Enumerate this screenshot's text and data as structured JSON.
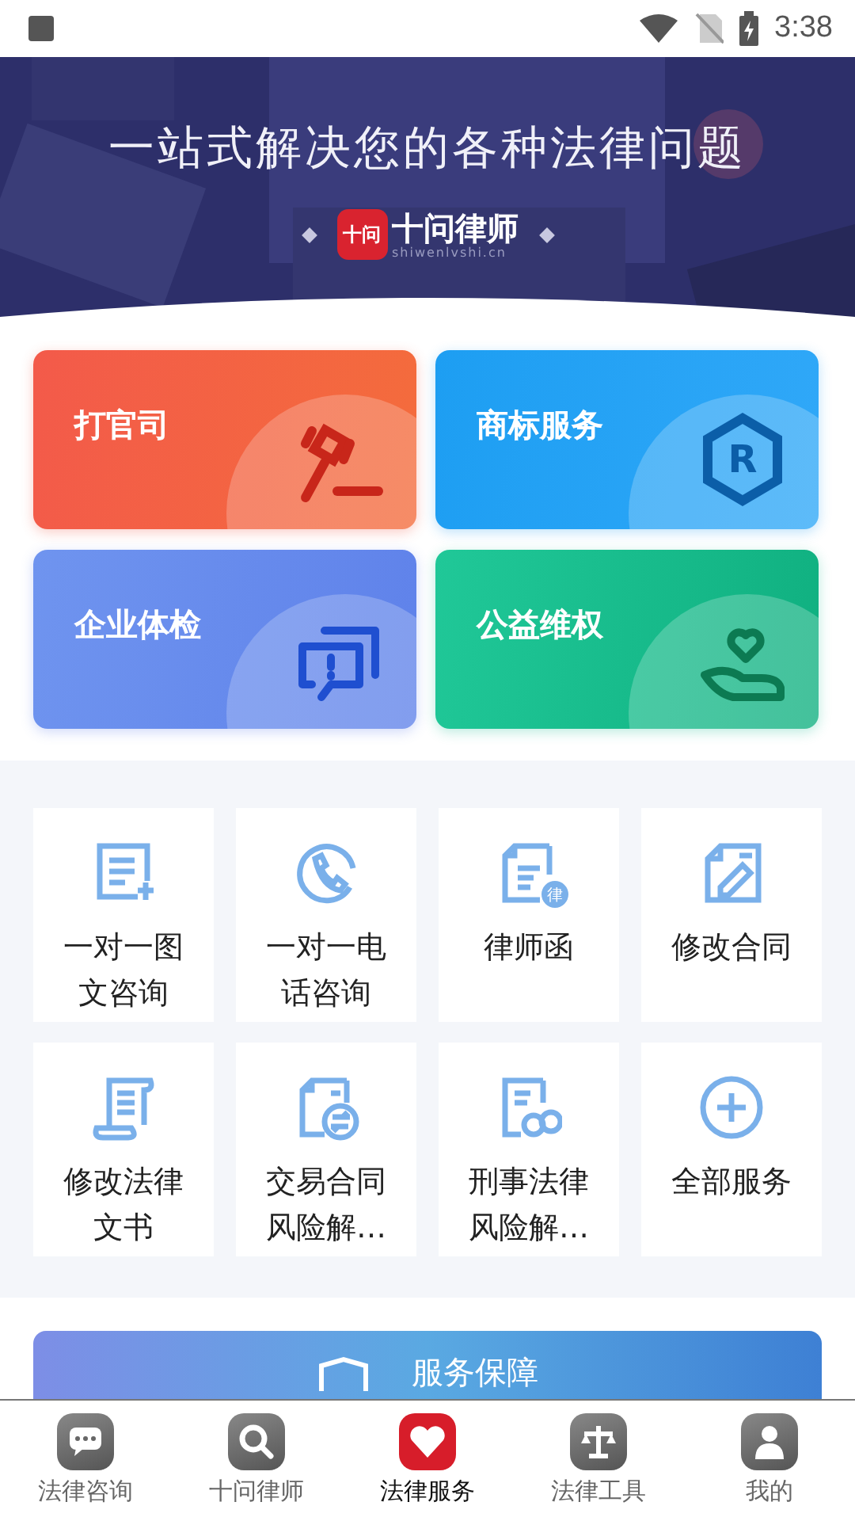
{
  "status_bar": {
    "time": "3:38"
  },
  "banner": {
    "title": "一站式解决您的各种法律问题",
    "logo_mark": "十问",
    "brand": "十问律师",
    "domain": "shiwenlvshi.cn"
  },
  "feature_cards": [
    {
      "label": "打官司",
      "kind": "gavel"
    },
    {
      "label": "商标服务",
      "kind": "trademark",
      "icon_text": "R"
    },
    {
      "label": "企业体检",
      "kind": "checkup"
    },
    {
      "label": "公益维权",
      "kind": "charity"
    }
  ],
  "services": [
    {
      "label": "一对一图文咨询",
      "kind": "doc-plus"
    },
    {
      "label": "一对一电话咨询",
      "kind": "phone"
    },
    {
      "label": "律师函",
      "kind": "letter",
      "icon_text": "律"
    },
    {
      "label": "修改合同",
      "kind": "edit"
    },
    {
      "label": "修改法律文书",
      "kind": "scroll"
    },
    {
      "label": "交易合同风险解…",
      "kind": "exchange"
    },
    {
      "label": "刑事法律风险解…",
      "kind": "criminal"
    },
    {
      "label": "全部服务",
      "kind": "plus"
    }
  ],
  "promo": {
    "title": "服务保障"
  },
  "tabs": [
    {
      "label": "法律咨询",
      "kind": "chat",
      "selected": false
    },
    {
      "label": "十问律师",
      "kind": "search",
      "selected": false
    },
    {
      "label": "法律服务",
      "kind": "heart",
      "selected": true
    },
    {
      "label": "法律工具",
      "kind": "scale",
      "selected": false
    },
    {
      "label": "我的",
      "kind": "person",
      "selected": false
    }
  ]
}
